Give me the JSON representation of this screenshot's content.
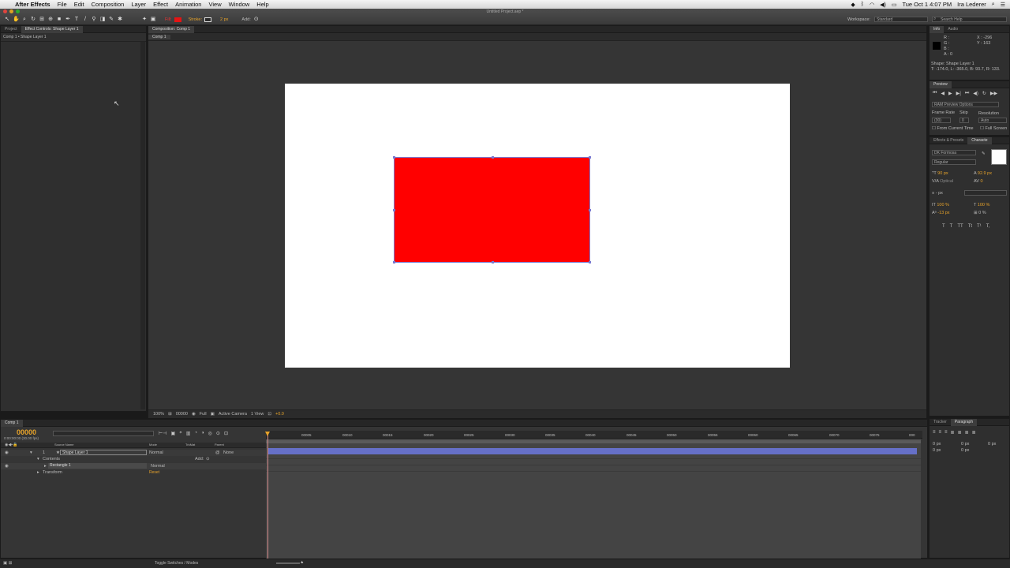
{
  "menubar": {
    "apple": "",
    "app": "After Effects",
    "items": [
      "File",
      "Edit",
      "Composition",
      "Layer",
      "Effect",
      "Animation",
      "View",
      "Window",
      "Help"
    ],
    "clock": "Tue Oct 1  4:07 PM",
    "user": "Ira Lederer"
  },
  "toolbar": {
    "window_title": "Untitled Project.aep *",
    "fill_label": "Fill:",
    "stroke_label": "Stroke:",
    "stroke_width": "2 px",
    "add_label": "Add:",
    "workspace_label": "Workspace:",
    "workspace_value": "Standard",
    "search_placeholder": "Search Help",
    "fill_color": "#e51414"
  },
  "left_panel": {
    "tab_project": "Project",
    "tab_effect_controls": "Effect Controls: Shape Layer 1",
    "breadcrumb": "Comp 1 • Shape Layer 1"
  },
  "comp_panel": {
    "tab": "Composition: Comp 1",
    "subtab": "Comp 1",
    "zoom": "100%",
    "timecode": "00000",
    "resolution": "Full",
    "camera": "Active Camera",
    "view": "1 View",
    "exposure": "+0.0"
  },
  "info_panel": {
    "tab_info": "Info",
    "tab_audio": "Audio",
    "r": "R :",
    "g": "G :",
    "b": "B :",
    "a": "A : 0",
    "x": "X : -296",
    "y": "Y : 163",
    "layer_label": "Shape: Shape Layer 1",
    "bounds": "T: -174.0, L: -365.0, B: 93.7, R: 133."
  },
  "preview_panel": {
    "tab": "Preview",
    "ram_options": "RAM Preview Options",
    "frame_rate_label": "Frame Rate",
    "skip_label": "Skip",
    "resolution_label": "Resolution",
    "frame_rate_value": "(30)",
    "skip_value": "0",
    "resolution_value": "Auto",
    "from_current": "From Current Time",
    "full_screen": "Full Screen"
  },
  "character_panel": {
    "tab_effects": "Effects & Presets",
    "tab_character": "Characte",
    "font": "DK Formosa",
    "style": "Regular",
    "size": "90 px",
    "leading": "92.9 px",
    "kerning": "Optical",
    "tracking": "0",
    "stroke": "- px",
    "vscale": "100 %",
    "hscale": "100 %",
    "baseline": "-13 px",
    "tsume": "0 %",
    "styles": [
      "T",
      "T",
      "TT",
      "Tt",
      "T¹",
      "T,"
    ]
  },
  "paragraph_panel": {
    "tab_tracker": "Tracker",
    "tab_paragraph": "Paragraph",
    "indent_left": "0 px",
    "indent_right": "0 px",
    "space_before": "0 px",
    "space_after": "0 px",
    "first_line": "0 px"
  },
  "timeline": {
    "tab": "Comp 1",
    "timecode": "00000",
    "timecode_sub": "0:00:00:00 (30.00 fps)",
    "search_placeholder": "",
    "columns": {
      "source": "Source Name",
      "mode": "Mode",
      "trkmat": "TrkMat",
      "parent": "Parent"
    },
    "layer": {
      "index": "1",
      "name": "Shape Layer 1",
      "mode": "Normal",
      "parent": "None"
    },
    "contents_label": "Contents",
    "add_label": "Add:",
    "rect_label": "Rectangle 1",
    "rect_mode": "Normal",
    "transform_label": "Transform",
    "reset_label": "Reset",
    "ruler_ticks": [
      "00005",
      "00010",
      "00015",
      "00020",
      "00025",
      "00030",
      "00035",
      "00040",
      "00045",
      "00050",
      "00055",
      "00060",
      "00065",
      "00070",
      "00075",
      "000"
    ],
    "toggle_label": "Toggle Switches / Modes"
  }
}
